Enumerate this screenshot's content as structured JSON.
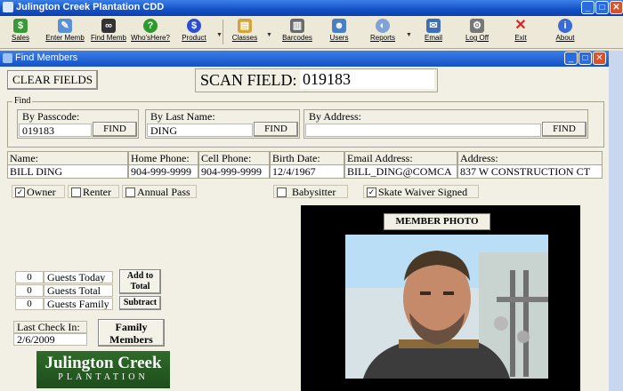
{
  "window": {
    "title": "Julington Creek Plantation CDD"
  },
  "toolbar": {
    "items": [
      {
        "label": "Sales",
        "icon": "sales-icon"
      },
      {
        "label": "Enter Memb",
        "icon": "enter-member-icon"
      },
      {
        "label": "Find Memb",
        "icon": "binoculars-icon"
      },
      {
        "label": "Who'sHere?",
        "icon": "help-icon"
      },
      {
        "label": "Product",
        "icon": "product-icon"
      },
      {
        "label": "Classes",
        "icon": "classes-icon"
      },
      {
        "label": "Barcodes",
        "icon": "barcode-icon"
      },
      {
        "label": "Users",
        "icon": "users-icon"
      },
      {
        "label": "Reports",
        "icon": "reports-icon"
      },
      {
        "label": "Email",
        "icon": "email-icon"
      },
      {
        "label": "Log Off",
        "icon": "logoff-icon"
      },
      {
        "label": "Exit",
        "icon": "exit-icon"
      },
      {
        "label": "About",
        "icon": "about-icon"
      }
    ]
  },
  "child_window": {
    "title": "Find Members"
  },
  "controls": {
    "clear_fields": "CLEAR FIELDS",
    "scan_label": "SCAN FIELD:",
    "scan_value": "019183"
  },
  "find": {
    "group_label": "Find",
    "passcode_label": "By Passcode:",
    "passcode_value": "019183",
    "lastname_label": "By Last Name:",
    "lastname_value": "DING",
    "address_label": "By Address:",
    "address_value": "",
    "find_button": "FIND"
  },
  "member_grid": {
    "headers": [
      "Name:",
      "Home Phone:",
      "Cell Phone:",
      "Birth Date:",
      "Email Address:",
      "Address:"
    ],
    "values": [
      "BILL DING",
      "904-999-9999",
      "904-999-9999",
      "12/4/1967",
      "BILL_DING@COMCA",
      "837 W CONSTRUCTION CT"
    ]
  },
  "checkboxes": [
    {
      "label": "Owner",
      "checked": true
    },
    {
      "label": "Renter",
      "checked": false
    },
    {
      "label": "Annual Pass",
      "checked": false
    },
    {
      "label": "Babysitter",
      "checked": false
    },
    {
      "label": "Skate Waiver Signed",
      "checked": true
    }
  ],
  "guests": {
    "today_count": "0",
    "today_label": "Guests Today",
    "total_count": "0",
    "total_label": "Guests Total",
    "family_count": "0",
    "family_label": "Guests Family",
    "add_button": "Add to Total",
    "subtract_button": "Subtract"
  },
  "checkin": {
    "label": "Last Check In:",
    "value": "2/6/2009"
  },
  "family_button": "Family Members",
  "photo": {
    "label": "MEMBER PHOTO"
  },
  "logo": {
    "line1": "Julington Creek",
    "line2": "PLANTATION"
  },
  "colors": {
    "titlebar": "#1451c6",
    "panel": "#f2f0e4",
    "logo": "#2f6b2a"
  }
}
